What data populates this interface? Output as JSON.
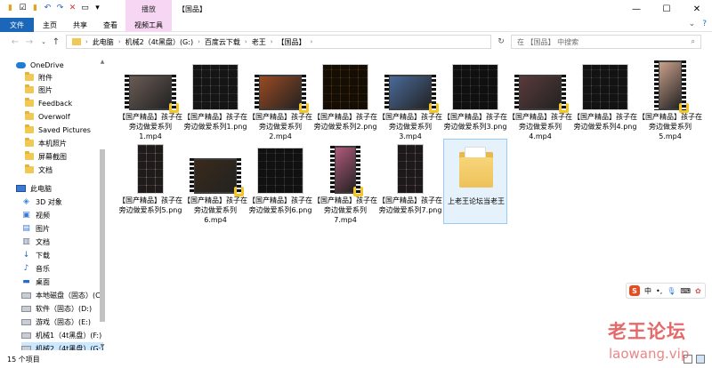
{
  "window": {
    "title": "【国品】",
    "context_tab_top": "播放",
    "minimize": "—",
    "maximize": "☐",
    "close": "✕"
  },
  "ribbon": {
    "tabs": [
      "文件",
      "主页",
      "共享",
      "查看",
      "视频工具"
    ]
  },
  "address": {
    "path": [
      "此电脑",
      "机械2（4t黑盘）(G:)",
      "百度云下载",
      "老王",
      "【国品】"
    ],
    "search_placeholder": "在 【国品】 中搜索"
  },
  "nav": [
    {
      "label": "OneDrive",
      "icon": "onedrive-icon"
    },
    {
      "label": "附件",
      "icon": "folder-icon"
    },
    {
      "label": "图片",
      "icon": "folder-icon"
    },
    {
      "label": "Feedback",
      "icon": "folder-icon"
    },
    {
      "label": "Overwolf",
      "icon": "folder-icon"
    },
    {
      "label": "Saved Pictures",
      "icon": "folder-icon"
    },
    {
      "label": "本机照片",
      "icon": "folder-icon"
    },
    {
      "label": "屏幕截图",
      "icon": "folder-icon"
    },
    {
      "label": "文档",
      "icon": "folder-icon"
    },
    {
      "label": "此电脑",
      "icon": "pc-icon"
    },
    {
      "label": "3D 对象",
      "icon": "cube-icon"
    },
    {
      "label": "视频",
      "icon": "video-icon"
    },
    {
      "label": "图片",
      "icon": "pictures-icon"
    },
    {
      "label": "文档",
      "icon": "documents-icon"
    },
    {
      "label": "下载",
      "icon": "download-icon"
    },
    {
      "label": "音乐",
      "icon": "music-icon"
    },
    {
      "label": "桌面",
      "icon": "desktop-icon"
    },
    {
      "label": "本地磁盘（固态）(C:)",
      "icon": "drive-icon"
    },
    {
      "label": "软件（固态）(D:)",
      "icon": "drive-icon"
    },
    {
      "label": "游戏（固态）(E:)",
      "icon": "drive-icon"
    },
    {
      "label": "机械1（4t黑盘）(F:)",
      "icon": "drive-icon"
    },
    {
      "label": "机械2（4t黑盘）(G:)",
      "icon": "drive-icon"
    }
  ],
  "files": [
    {
      "name": "【国产精品】孩子在旁边做爱系列1.mp4",
      "kind": "video",
      "tone": "#6a5b55"
    },
    {
      "name": "【国产精品】孩子在旁边做爱系列1.png",
      "kind": "grid",
      "tone": "#888888"
    },
    {
      "name": "【国产精品】孩子在旁边做爱系列2.mp4",
      "kind": "video",
      "tone": "#9a4a22"
    },
    {
      "name": "【国产精品】孩子在旁边做爱系列2.png",
      "kind": "grid",
      "tone": "#8a5a20"
    },
    {
      "name": "【国产精品】孩子在旁边做爱系列3.mp4",
      "kind": "video",
      "tone": "#4a6a9a"
    },
    {
      "name": "【国产精品】孩子在旁边做爱系列3.png",
      "kind": "grid",
      "tone": "#6a6a6a"
    },
    {
      "name": "【国产精品】孩子在旁边做爱系列4.mp4",
      "kind": "video",
      "tone": "#5a3a3a"
    },
    {
      "name": "【国产精品】孩子在旁边做爱系列4.png",
      "kind": "grid",
      "tone": "#7a7a7a"
    },
    {
      "name": "【国产精品】孩子在旁边做爱系列5.mp4",
      "kind": "video",
      "tone": "#c9a08a"
    },
    {
      "name": "【国产精品】孩子在旁边做爱系列5.png",
      "kind": "grid",
      "tone": "#c9b0a8"
    },
    {
      "name": "【国产精品】孩子在旁边做爱系列6.mp4",
      "kind": "video",
      "tone": "#3a2a1a"
    },
    {
      "name": "【国产精品】孩子在旁边做爱系列6.png",
      "kind": "grid",
      "tone": "#6f6f6f"
    },
    {
      "name": "【国产精品】孩子在旁边做爱系列7.mp4",
      "kind": "video",
      "tone": "#b05a7a"
    },
    {
      "name": "【国产精品】孩子在旁边做爱系列7.png",
      "kind": "grid",
      "tone": "#b89aa8"
    },
    {
      "name": "上老王论坛当老王",
      "kind": "folder",
      "tone": "#eec25a"
    }
  ],
  "status": {
    "count": "15 个项目"
  },
  "ime": {
    "logo": "S",
    "lang": "中"
  },
  "watermark": {
    "line1": "老王论坛",
    "line2": "laowang.vip"
  }
}
